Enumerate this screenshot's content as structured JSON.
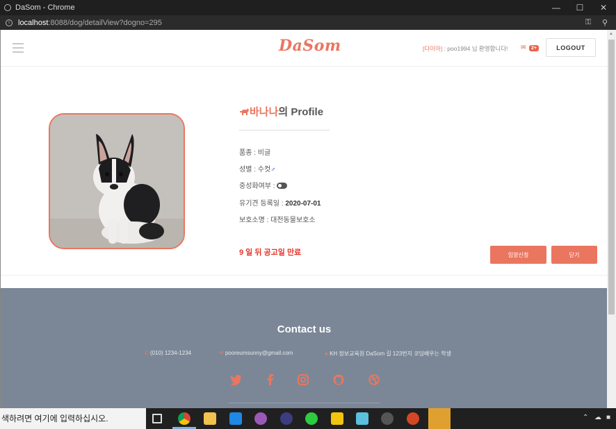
{
  "window": {
    "title": "DaSom - Chrome",
    "url_host": "localhost",
    "url_path": ":8088/dog/detailView?dogno=295"
  },
  "navbar": {
    "logo": "DaSom",
    "grade": "[다이아]",
    "welcome": ": poo1994 님 환영합니다!",
    "message_count": "2+",
    "logout_label": "LOGOUT"
  },
  "profile": {
    "dog_name": "바나나",
    "title_suffix_ko": "의",
    "title_suffix_en": "Profile",
    "fields": [
      {
        "label": "품종 : ",
        "value": "비글"
      },
      {
        "label": "성별 : ",
        "value": "수컷"
      },
      {
        "label": "중성화여부 : ",
        "value": ""
      },
      {
        "label": "유기견 등록일 : ",
        "value": "2020-07-01"
      },
      {
        "label": "보호소명 : ",
        "value": "대전동물보호소"
      }
    ],
    "neutered": true,
    "expire_text": "9 일 뒤 공고일 만료",
    "adopt_button": "입양신청",
    "close_button": "닫기"
  },
  "footer": {
    "title": "Contact us",
    "phone": "(010) 1234-1234",
    "email": "pooreumsunny@gmail.com",
    "address": "KH 정보교육원 DaSom 길 123번지 코딩배우는 학생",
    "social_icons": [
      "twitter-icon",
      "facebook-icon",
      "instagram-icon",
      "github-icon",
      "dribbble-icon"
    ]
  },
  "taskbar": {
    "search_placeholder": "색하려면 여기에 입력하십시오."
  },
  "colors": {
    "accent": "#ea7660",
    "footer_bg": "#7b8797",
    "expire": "#e53529"
  }
}
